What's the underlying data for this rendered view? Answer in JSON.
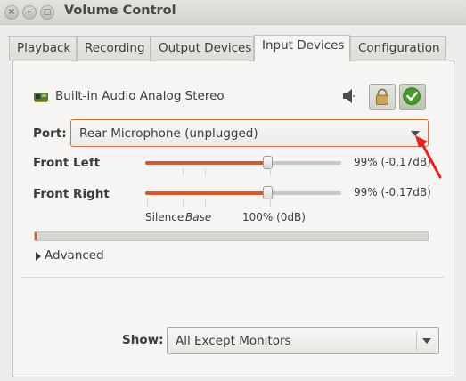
{
  "window": {
    "title": "Volume Control",
    "controls": {
      "close": "×",
      "minimize": "–",
      "maximize": "□"
    }
  },
  "tabs": [
    {
      "label": "Playback",
      "active": false
    },
    {
      "label": "Recording",
      "active": false
    },
    {
      "label": "Output Devices",
      "active": false
    },
    {
      "label": "Input Devices",
      "active": true
    },
    {
      "label": "Configuration",
      "active": false
    }
  ],
  "device": {
    "name": "Built-in Audio Analog Stereo",
    "icons": [
      "sound-card-icon",
      "speaker-mute-icon",
      "lock-icon",
      "set-default-check-icon"
    ],
    "port_label": "Port:",
    "port_value": "Rear Microphone (unplugged)",
    "channels": [
      {
        "label": "Front Left",
        "value_text": "99% (-0,17dB)",
        "level": 0.99
      },
      {
        "label": "Front Right",
        "value_text": "99% (-0,17dB)",
        "level": 0.99
      }
    ],
    "scale": {
      "silence": "Silence",
      "base": "Base",
      "full": "100% (0dB)"
    },
    "meter_level": 0.005,
    "advanced_label": "Advanced"
  },
  "footer": {
    "show_label": "Show:",
    "show_value": "All Except Monitors"
  },
  "colors": {
    "accent": "#d4582a",
    "annotation": "#e8231f"
  }
}
